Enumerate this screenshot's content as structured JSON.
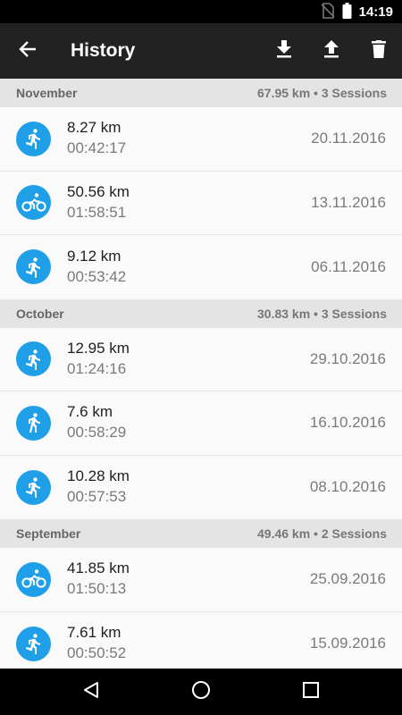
{
  "status_bar": {
    "time": "14:19"
  },
  "app_bar": {
    "title": "History"
  },
  "sections": [
    {
      "month": "November",
      "summary": "67.95 km • 3  Sessions",
      "sessions": [
        {
          "activity": "running-icon",
          "distance": "8.27 km",
          "duration": "00:42:17",
          "date": "20.11.2016"
        },
        {
          "activity": "cycling-icon",
          "distance": "50.56 km",
          "duration": "01:58:51",
          "date": "13.11.2016"
        },
        {
          "activity": "running-icon",
          "distance": "9.12 km",
          "duration": "00:53:42",
          "date": "06.11.2016"
        }
      ]
    },
    {
      "month": "October",
      "summary": "30.83 km • 3  Sessions",
      "sessions": [
        {
          "activity": "running-icon",
          "distance": "12.95 km",
          "duration": "01:24:16",
          "date": "29.10.2016"
        },
        {
          "activity": "walking-icon",
          "distance": "7.6 km",
          "duration": "00:58:29",
          "date": "16.10.2016"
        },
        {
          "activity": "running-icon",
          "distance": "10.28 km",
          "duration": "00:57:53",
          "date": "08.10.2016"
        }
      ]
    },
    {
      "month": "September",
      "summary": "49.46 km • 2  Sessions",
      "sessions": [
        {
          "activity": "cycling-icon",
          "distance": "41.85 km",
          "duration": "01:50:13",
          "date": "25.09.2016"
        },
        {
          "activity": "running-icon",
          "distance": "7.61 km",
          "duration": "00:50:52",
          "date": "15.09.2016"
        }
      ]
    }
  ],
  "colors": {
    "accent": "#1e9fe8",
    "app_bar": "#222222",
    "section_bg": "#e4e4e4"
  }
}
